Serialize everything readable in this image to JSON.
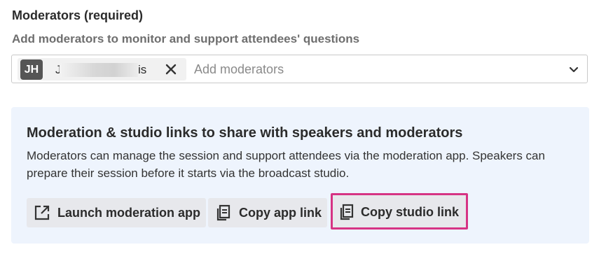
{
  "field": {
    "label": "Moderators (required)",
    "help_text": "Add moderators to monitor and support attendees' questions"
  },
  "moderators_select": {
    "chips": [
      {
        "initials": "JH",
        "name_start": "J",
        "name_end": "is"
      }
    ],
    "placeholder": "Add moderators",
    "remove_icon": "close-icon",
    "toggle_icon": "chevron-down-icon"
  },
  "info_panel": {
    "title": "Moderation & studio links to share with speakers and moderators",
    "description": "Moderators can manage the session and support attendees via the moderation app. Speakers can prepare their session before it starts via the broadcast studio.",
    "actions": {
      "launch_label": "Launch moderation app",
      "launch_icon": "external-link-icon",
      "copy_app_label": "Copy app link",
      "copy_app_icon": "copy-icon",
      "copy_studio_label": "Copy studio link",
      "copy_studio_icon": "copy-icon"
    }
  },
  "colors": {
    "panel_background": "#eef4fd",
    "button_background": "#e7e8ec",
    "highlight_border": "#d63384",
    "avatar_background": "#555555"
  }
}
